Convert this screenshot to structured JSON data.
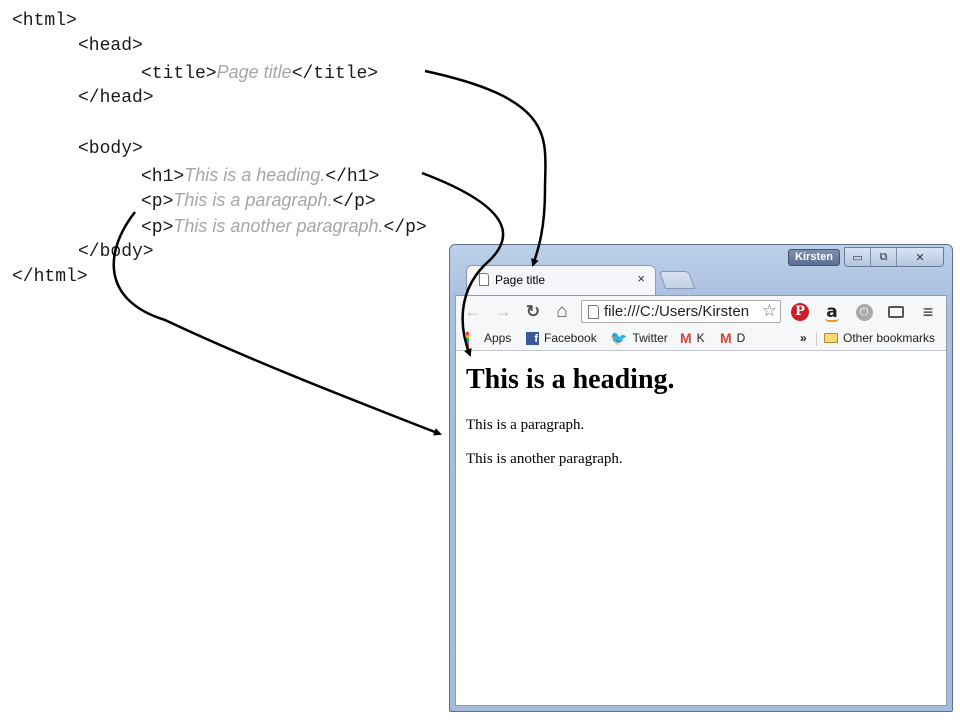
{
  "code": {
    "html_open": "<html>",
    "head_open": "<head>",
    "title_open": "<title>",
    "title_value": "Page title",
    "title_close": "</title>",
    "head_close": "</head>",
    "body_open": "<body>",
    "h1_open": "<h1>",
    "h1_value": "This is a heading.",
    "h1_close": "</h1>",
    "p_open": "<p>",
    "p1_value": "This is a paragraph.",
    "p_close": "</p>",
    "p2_value": "This is another paragraph.",
    "body_close": "</body>",
    "html_close": "</html>"
  },
  "browser": {
    "user": "Kirsten",
    "window_buttons": {
      "minimize": "▭",
      "maximize": "⧉",
      "close": "✕"
    },
    "tab": {
      "title": "Page title",
      "close": "×"
    },
    "nav": {
      "back": "←",
      "forward": "→",
      "reload": "↻",
      "home": "⌂"
    },
    "address": "file:///C:/Users/Kirsten",
    "star": "☆",
    "extensions": {
      "pinterest": "P",
      "amazon": "a",
      "power": "⏻",
      "menu": "≡"
    },
    "bookmarks": {
      "apps": "Apps",
      "facebook": "Facebook",
      "twitter": "Twitter",
      "gmail_k": "K",
      "gmail_d": "D",
      "overflow": "»",
      "other": "Other bookmarks"
    },
    "bookmark_icons": {
      "facebook": "f",
      "twitter": "🐦",
      "gmail": "M"
    },
    "page": {
      "heading": "This is a heading.",
      "paragraph1": "This is a paragraph.",
      "paragraph2": "This is another paragraph."
    }
  },
  "colors": {
    "code_value": "#a6a6a6",
    "window_frame": "#a9bfde",
    "arrow": "#000000"
  },
  "icons": {
    "apps": "apps-grid-icon",
    "folder": "folder-icon",
    "page": "page-icon"
  }
}
